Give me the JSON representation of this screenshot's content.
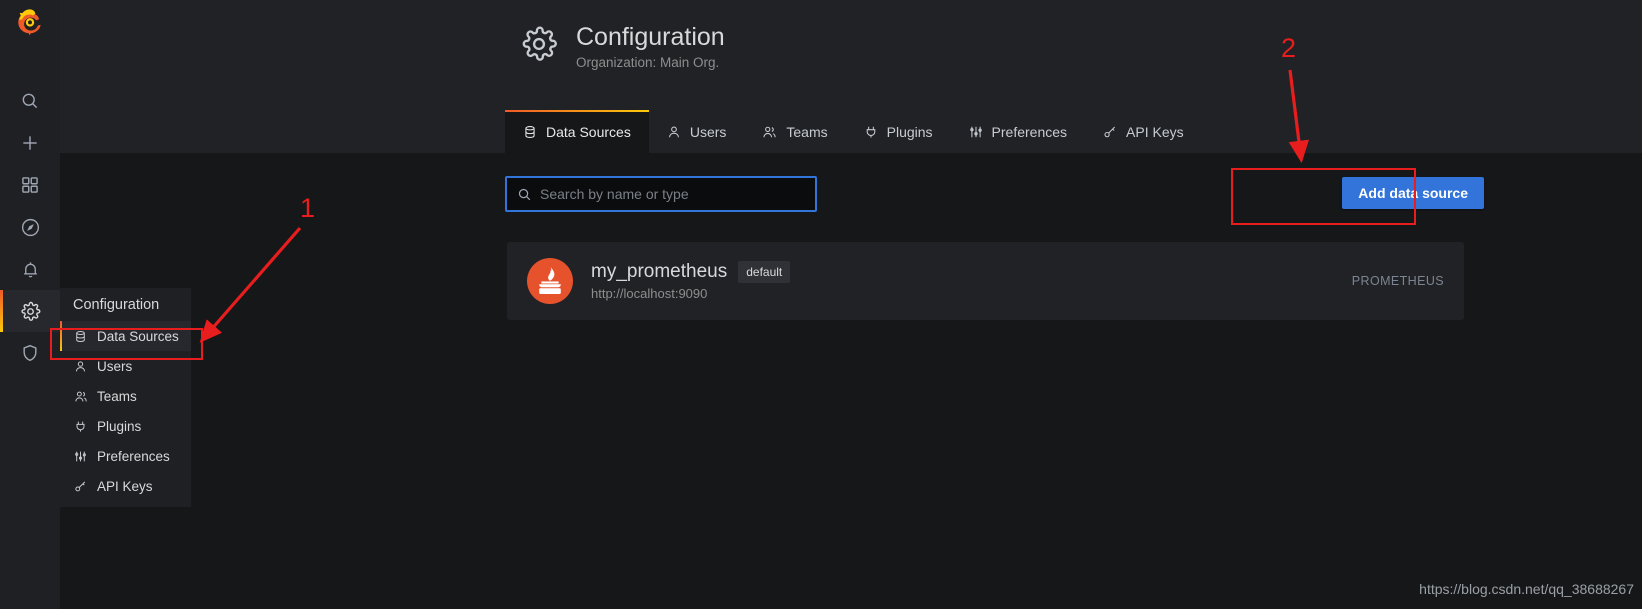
{
  "sidebar": {
    "logo_name": "grafana-logo",
    "items": [
      {
        "name": "search-icon",
        "label": "Search"
      },
      {
        "name": "plus-icon",
        "label": "Create"
      },
      {
        "name": "dashboards-icon",
        "label": "Dashboards"
      },
      {
        "name": "explore-icon",
        "label": "Explore"
      },
      {
        "name": "alerting-icon",
        "label": "Alerting"
      },
      {
        "name": "gear-icon",
        "label": "Configuration",
        "active": true
      },
      {
        "name": "shield-icon",
        "label": "Server Admin"
      }
    ]
  },
  "flyout": {
    "header": "Configuration",
    "items": [
      {
        "label": "Data Sources",
        "icon": "database-icon",
        "selected": true
      },
      {
        "label": "Users",
        "icon": "user-icon"
      },
      {
        "label": "Teams",
        "icon": "users-icon"
      },
      {
        "label": "Plugins",
        "icon": "plug-icon"
      },
      {
        "label": "Preferences",
        "icon": "sliders-icon"
      },
      {
        "label": "API Keys",
        "icon": "key-icon"
      }
    ]
  },
  "header": {
    "icon": "gear-icon",
    "title": "Configuration",
    "subtitle": "Organization: Main Org."
  },
  "tabs": [
    {
      "label": "Data Sources",
      "icon": "database-icon",
      "active": true
    },
    {
      "label": "Users",
      "icon": "user-icon"
    },
    {
      "label": "Teams",
      "icon": "users-icon"
    },
    {
      "label": "Plugins",
      "icon": "plug-icon"
    },
    {
      "label": "Preferences",
      "icon": "sliders-icon"
    },
    {
      "label": "API Keys",
      "icon": "key-icon"
    }
  ],
  "toolbar": {
    "search_placeholder": "Search by name or type",
    "search_value": "",
    "add_button_label": "Add data source"
  },
  "data_sources": [
    {
      "name": "my_prometheus",
      "badge": "default",
      "url": "http://localhost:9090",
      "type": "PROMETHEUS",
      "logo": "prometheus-logo"
    }
  ],
  "annotations": [
    {
      "number": "1",
      "target": "flyout Data Sources item"
    },
    {
      "number": "2",
      "target": "Add data source button"
    }
  ],
  "watermark": "https://blog.csdn.net/qq_38688267",
  "colors": {
    "accent_blue": "#3274d9",
    "annotation_red": "#e81d1d",
    "brand_orange": "#f05a28",
    "brand_yellow": "#fbca0a",
    "panel_bg": "#212226",
    "page_bg": "#161719",
    "sidebar_bg": "#1f2024"
  }
}
